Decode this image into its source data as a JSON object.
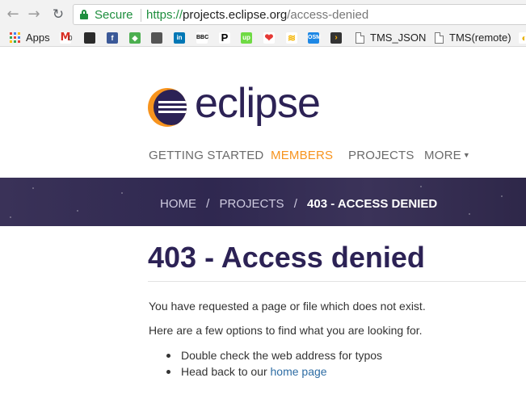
{
  "browser": {
    "secure_label": "Secure",
    "url_scheme": "https://",
    "url_host": "projects.eclipse.org",
    "url_path": "/access-denied",
    "bookmarks": {
      "apps_label": "Apps",
      "gmail_badge": "0",
      "tms_json_label": "TMS_JSON",
      "tms_remote_label": "TMS(remote)"
    }
  },
  "site": {
    "logo_text": "eclipse",
    "nav": {
      "getting_started": "GETTING STARTED",
      "members": "MEMBERS",
      "projects": "PROJECTS",
      "more": "MORE"
    },
    "breadcrumb": {
      "home": "HOME",
      "sep": "/",
      "projects": "PROJECTS",
      "current": "403 - ACCESS DENIED"
    }
  },
  "content": {
    "title": "403 - Access denied",
    "paragraph1": "You have requested a page or file which does not exist.",
    "paragraph2": "Here are a few options to find what you are looking for.",
    "option1": "Double check the web address for typos",
    "option2_prefix": "Head back to our ",
    "option2_link": "home page"
  },
  "colors": {
    "brand_purple": "#2c2255",
    "brand_orange": "#f7941e",
    "secure_green": "#1e8e3e",
    "link_blue": "#2e6da4"
  }
}
